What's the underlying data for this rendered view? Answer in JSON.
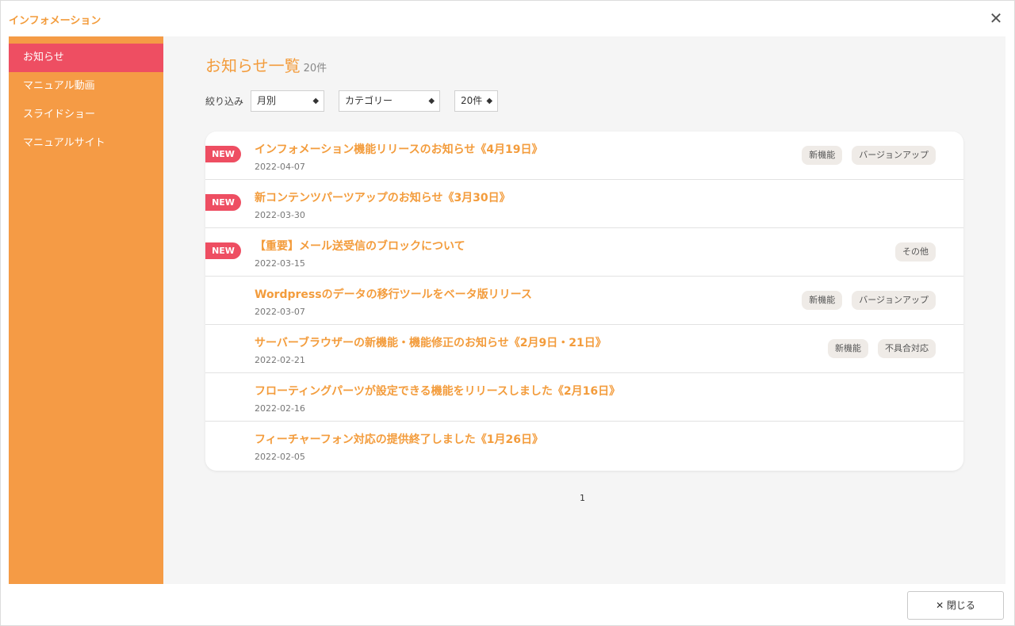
{
  "app": {
    "title": "インフォメーション",
    "close_glyph": "✕"
  },
  "sidebar": {
    "items": [
      {
        "label": "お知らせ",
        "active": true
      },
      {
        "label": "マニュアル動画",
        "active": false
      },
      {
        "label": "スライドショー",
        "active": false
      },
      {
        "label": "マニュアルサイト",
        "active": false
      }
    ]
  },
  "main": {
    "title": "お知らせ一覧",
    "count": "20件",
    "filters": {
      "label": "絞り込み",
      "month": "月別",
      "category": "カテゴリー",
      "per_page": "20件"
    },
    "news": [
      {
        "is_new": true,
        "badge": "NEW",
        "title": "インフォメーション機能リリースのお知らせ《4月19日》",
        "date": "2022-04-07",
        "tags": [
          "新機能",
          "バージョンアップ"
        ]
      },
      {
        "is_new": true,
        "badge": "NEW",
        "title": "新コンテンツパーツアップのお知らせ《3月30日》",
        "date": "2022-03-30",
        "tags": []
      },
      {
        "is_new": true,
        "badge": "NEW",
        "title": "【重要】メール送受信のブロックについて",
        "date": "2022-03-15",
        "tags": [
          "その他"
        ]
      },
      {
        "is_new": false,
        "badge": "",
        "title": "Wordpressのデータの移行ツールをベータ版リリース",
        "date": "2022-03-07",
        "tags": [
          "新機能",
          "バージョンアップ"
        ]
      },
      {
        "is_new": false,
        "badge": "",
        "title": "サーバーブラウザーの新機能・機能修正のお知らせ《2月9日・21日》",
        "date": "2022-02-21",
        "tags": [
          "新機能",
          "不具合対応"
        ]
      },
      {
        "is_new": false,
        "badge": "",
        "title": "フローティングパーツが設定できる機能をリリースしました《2月16日》",
        "date": "2022-02-16",
        "tags": []
      },
      {
        "is_new": false,
        "badge": "",
        "title": "フィーチャーフォン対応の提供終了しました《1月26日》",
        "date": "2022-02-05",
        "tags": []
      }
    ],
    "pagination": {
      "current": "1"
    }
  },
  "footer": {
    "close_label": "✕ 閉じる"
  },
  "colors": {
    "accent": "#f39c3c",
    "sidebar": "#f59b45",
    "active": "#ee4e62"
  }
}
